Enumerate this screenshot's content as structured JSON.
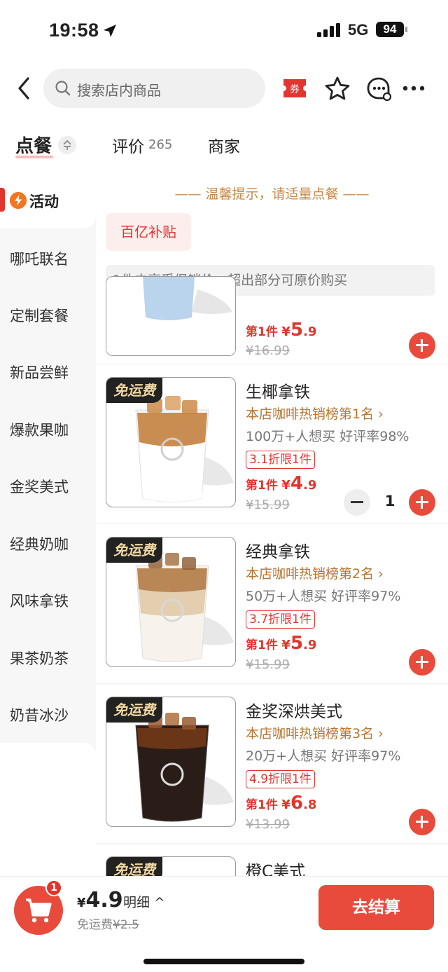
{
  "status_bar": {
    "time": "19:58",
    "network": "5G",
    "battery": "94"
  },
  "search": {
    "placeholder": "搜索店内商品"
  },
  "header": {
    "coupon_label": "券"
  },
  "tabs": [
    {
      "label": "点餐"
    },
    {
      "label": "评价",
      "count": "265"
    },
    {
      "label": "商家"
    }
  ],
  "sidebar": {
    "active": "活动",
    "items": [
      "哪吒联名",
      "定制套餐",
      "新品尝鲜",
      "爆款果咖",
      "金奖美式",
      "经典奶咖",
      "风味拿铁",
      "果茶奶茶",
      "奶昔冰沙"
    ]
  },
  "content": {
    "tip": "温馨提示，请适量点餐",
    "promo_tag": "百亿补贴",
    "promo_note": "1件内享受促销价，超出部分可原价购买"
  },
  "partial_product": {
    "price_prefix": "第1件",
    "currency": "¥",
    "price_int": "5",
    "price_dec": ".9",
    "original": "¥16.99"
  },
  "products": [
    {
      "badge": "免运费",
      "name": "生椰拿铁",
      "rank": "本店咖啡热销榜第1名 ›",
      "stats": "100万+人想买 好评率98%",
      "discount": "3.1折限1件",
      "price_prefix": "第1件",
      "currency": "¥",
      "price_int": "4",
      "price_dec": ".9",
      "original": "¥15.99",
      "quantity": "1"
    },
    {
      "badge": "免运费",
      "name": "经典拿铁",
      "rank": "本店咖啡热销榜第2名 ›",
      "stats": "50万+人想买 好评率97%",
      "discount": "3.7折限1件",
      "price_prefix": "第1件",
      "currency": "¥",
      "price_int": "5",
      "price_dec": ".9",
      "original": "¥15.99"
    },
    {
      "badge": "免运费",
      "name": "金奖深烘美式",
      "rank": "本店咖啡热销榜第3名 ›",
      "stats": "20万+人想买 好评率97%",
      "discount": "4.9折限1件",
      "price_prefix": "第1件",
      "currency": "¥",
      "price_int": "6",
      "price_dec": ".8",
      "original": "¥13.99"
    },
    {
      "badge": "免运费",
      "name": "橙C美式"
    }
  ],
  "cart": {
    "count": "1",
    "currency": "¥",
    "total": "4.9",
    "detail": "明细 ^",
    "delivery_label": "免运费",
    "delivery_original": "¥2.5",
    "checkout": "去结算"
  },
  "colors": {
    "accent": "#e84b3c",
    "price_red": "#e2352d",
    "rank_gold": "#b8742f",
    "tip_gold": "#c98a4a"
  }
}
